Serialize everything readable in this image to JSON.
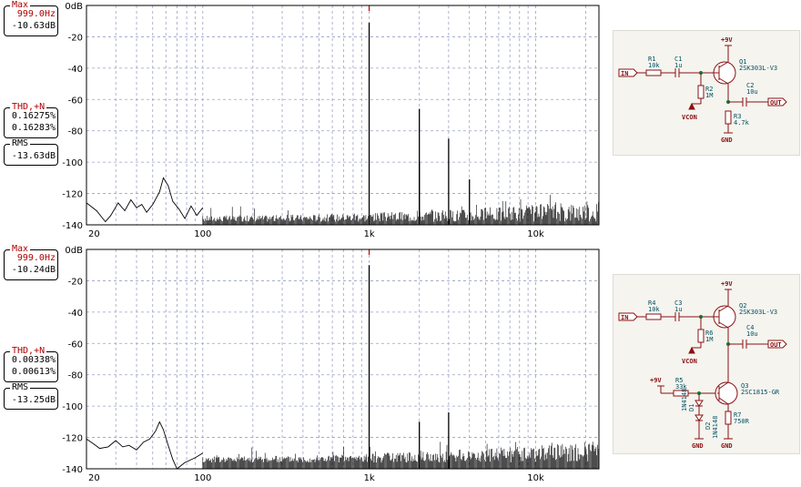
{
  "panels": [
    {
      "readouts": {
        "max": {
          "label": "Max",
          "freq": "999.0Hz",
          "level": "-10.63dB"
        },
        "thd": {
          "label": "THD,+N",
          "v1": "0.16275%",
          "v2": "0.16283%"
        },
        "rms": {
          "label": "RMS",
          "value": "-13.63dB"
        }
      },
      "schematic": {
        "in": "IN",
        "out": "OUT",
        "vcon": "VCON",
        "gnd": "GND",
        "vplus": "+9V",
        "r1": "R1",
        "r1v": "10k",
        "c1": "C1",
        "c1v": "1u",
        "r2": "R2",
        "r2v": "1M",
        "q1": "Q1",
        "q1v": "2SK303L-V3",
        "c2": "C2",
        "c2v": "10u",
        "r3": "R3",
        "r3v": "4.7k"
      }
    },
    {
      "readouts": {
        "max": {
          "label": "Max",
          "freq": "999.0Hz",
          "level": "-10.24dB"
        },
        "thd": {
          "label": "THD,+N",
          "v1": "0.00338%",
          "v2": "0.00613%"
        },
        "rms": {
          "label": "RMS",
          "value": "-13.25dB"
        }
      },
      "schematic": {
        "in": "IN",
        "out": "OUT",
        "vcon": "VCON",
        "gnd": "GND",
        "vplus": "+9V",
        "r4": "R4",
        "r4v": "10k",
        "c3": "C3",
        "c3v": "1u",
        "r6": "R6",
        "r6v": "1M",
        "q2": "Q2",
        "q2v": "2SK303L-V3",
        "c4": "C4",
        "c4v": "10u",
        "r5": "R5",
        "r5v": "33k",
        "q3": "Q3",
        "q3v": "2SC1815-GR",
        "d1": "D1",
        "d1v": "1N4148",
        "d2": "D2",
        "d2v": "1N4148",
        "r7": "R7",
        "r7v": "750R"
      }
    }
  ],
  "chart_data": [
    {
      "type": "line",
      "title": "",
      "xlabel": "",
      "ylabel": "",
      "x_scale": "log",
      "xlim": [
        20,
        24000
      ],
      "ylim": [
        -140,
        0
      ],
      "y_ticks": [
        "0dB",
        "-20",
        "-40",
        "-60",
        "-80",
        "-100",
        "-120",
        "-140"
      ],
      "x_ticks": [
        "20",
        "100",
        "1k",
        "10k"
      ],
      "grid": true,
      "series_color": "#000000",
      "peaks": [
        {
          "x": 999,
          "y": -11
        },
        {
          "x": 2000,
          "y": -66
        },
        {
          "x": 2000,
          "y": -100
        },
        {
          "x": 3000,
          "y": -85
        },
        {
          "x": 4000,
          "y": -111
        }
      ],
      "low_band": [
        {
          "x": 20,
          "y": -126
        },
        {
          "x": 23,
          "y": -131
        },
        {
          "x": 26,
          "y": -138
        },
        {
          "x": 28,
          "y": -134
        },
        {
          "x": 31,
          "y": -126
        },
        {
          "x": 34,
          "y": -131
        },
        {
          "x": 37,
          "y": -124
        },
        {
          "x": 40,
          "y": -129
        },
        {
          "x": 43,
          "y": -127
        },
        {
          "x": 46,
          "y": -132
        },
        {
          "x": 50,
          "y": -127
        },
        {
          "x": 55,
          "y": -119
        },
        {
          "x": 58,
          "y": -110
        },
        {
          "x": 62,
          "y": -115
        },
        {
          "x": 66,
          "y": -125
        },
        {
          "x": 72,
          "y": -130
        },
        {
          "x": 78,
          "y": -136
        },
        {
          "x": 85,
          "y": -128
        },
        {
          "x": 92,
          "y": -134
        },
        {
          "x": 100,
          "y": -129
        }
      ],
      "noise_floor": -138
    },
    {
      "type": "line",
      "title": "",
      "xlabel": "",
      "ylabel": "",
      "x_scale": "log",
      "xlim": [
        20,
        24000
      ],
      "ylim": [
        -140,
        0
      ],
      "y_ticks": [
        "0dB",
        "-20",
        "-40",
        "-60",
        "-80",
        "-100",
        "-120",
        "-140"
      ],
      "x_ticks": [
        "20",
        "100",
        "1k",
        "10k"
      ],
      "grid": true,
      "series_color": "#000000",
      "peaks": [
        {
          "x": 999,
          "y": -10
        },
        {
          "x": 2000,
          "y": -110
        },
        {
          "x": 3000,
          "y": -104
        }
      ],
      "low_band": [
        {
          "x": 20,
          "y": -121
        },
        {
          "x": 22,
          "y": -124
        },
        {
          "x": 24,
          "y": -127
        },
        {
          "x": 27,
          "y": -126
        },
        {
          "x": 30,
          "y": -122
        },
        {
          "x": 33,
          "y": -126
        },
        {
          "x": 36,
          "y": -125
        },
        {
          "x": 40,
          "y": -128
        },
        {
          "x": 44,
          "y": -123
        },
        {
          "x": 48,
          "y": -121
        },
        {
          "x": 52,
          "y": -116
        },
        {
          "x": 55,
          "y": -110
        },
        {
          "x": 58,
          "y": -115
        },
        {
          "x": 62,
          "y": -125
        },
        {
          "x": 66,
          "y": -134
        },
        {
          "x": 70,
          "y": -140
        },
        {
          "x": 78,
          "y": -136
        },
        {
          "x": 90,
          "y": -133
        },
        {
          "x": 100,
          "y": -130
        }
      ],
      "noise_floor": -136
    }
  ]
}
